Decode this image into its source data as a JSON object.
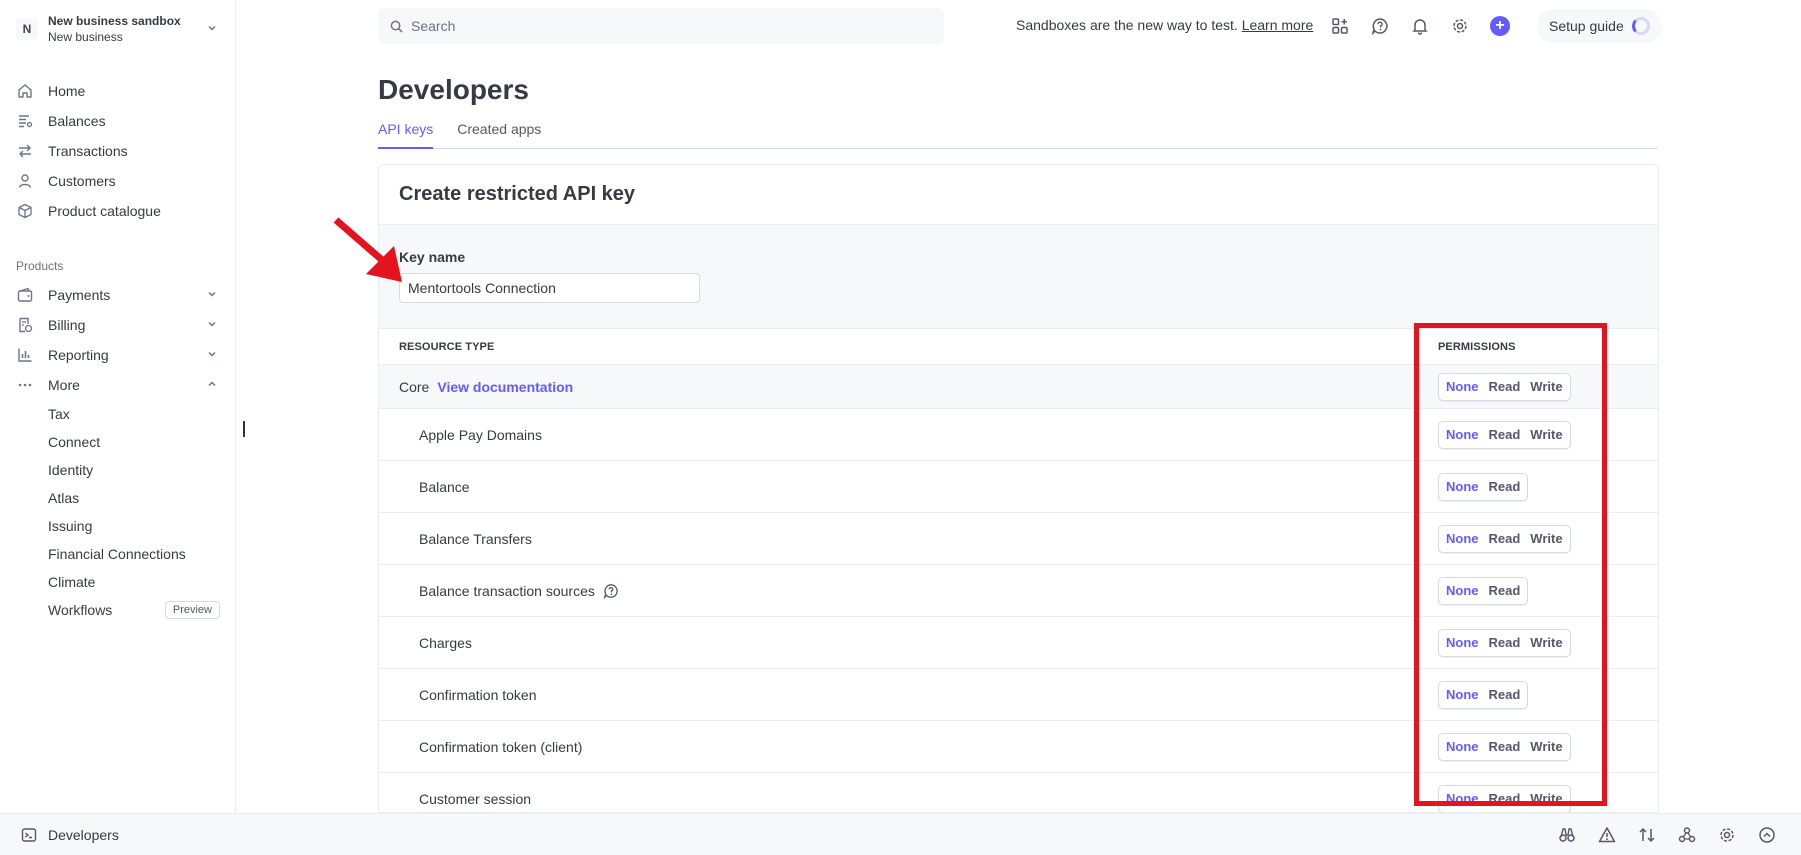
{
  "account": {
    "initial": "N",
    "name": "New business sandbox",
    "sub": "New business"
  },
  "nav": [
    {
      "label": "Home",
      "icon": "home-icon"
    },
    {
      "label": "Balances",
      "icon": "balances-icon"
    },
    {
      "label": "Transactions",
      "icon": "transactions-icon"
    },
    {
      "label": "Customers",
      "icon": "customers-icon"
    },
    {
      "label": "Product catalogue",
      "icon": "product-catalogue-icon"
    }
  ],
  "products_title": "Products",
  "products": [
    {
      "label": "Payments",
      "icon": "payments-icon",
      "expanded": false
    },
    {
      "label": "Billing",
      "icon": "billing-icon",
      "expanded": false
    },
    {
      "label": "Reporting",
      "icon": "reporting-icon",
      "expanded": false
    },
    {
      "label": "More",
      "icon": "more-icon",
      "expanded": true
    }
  ],
  "more_items": [
    "Tax",
    "Connect",
    "Identity",
    "Atlas",
    "Issuing",
    "Financial Connections",
    "Climate",
    "Workflows"
  ],
  "workflows_badge": "Preview",
  "search": {
    "placeholder": "Search"
  },
  "sandbox_note": {
    "text": "Sandboxes are the new way to test.",
    "link": "Learn more"
  },
  "setup_guide": "Setup guide",
  "page_title": "Developers",
  "tabs": [
    {
      "label": "API keys",
      "active": true
    },
    {
      "label": "Created apps",
      "active": false
    }
  ],
  "card": {
    "title": "Create restricted API key",
    "key_name_label": "Key name",
    "key_name_value": "Mentortools Connection",
    "col_resource": "RESOURCE TYPE",
    "col_permissions": "PERMISSIONS",
    "core_label": "Core",
    "core_link": "View documentation",
    "rows": [
      {
        "name": "Apple Pay Domains",
        "write": true,
        "help": false
      },
      {
        "name": "Balance",
        "write": false,
        "help": false
      },
      {
        "name": "Balance Transfers",
        "write": true,
        "help": false
      },
      {
        "name": "Balance transaction sources",
        "write": false,
        "help": true
      },
      {
        "name": "Charges",
        "write": true,
        "help": false
      },
      {
        "name": "Confirmation token",
        "write": false,
        "help": false
      },
      {
        "name": "Confirmation token (client)",
        "write": true,
        "help": false
      },
      {
        "name": "Customer session",
        "write": true,
        "help": false
      }
    ],
    "perm_labels": {
      "none": "None",
      "read": "Read",
      "write": "Write"
    }
  },
  "bottom_bar": {
    "label": "Developers"
  },
  "colors": {
    "accent": "#635bff",
    "annotation": "#e3141d"
  }
}
